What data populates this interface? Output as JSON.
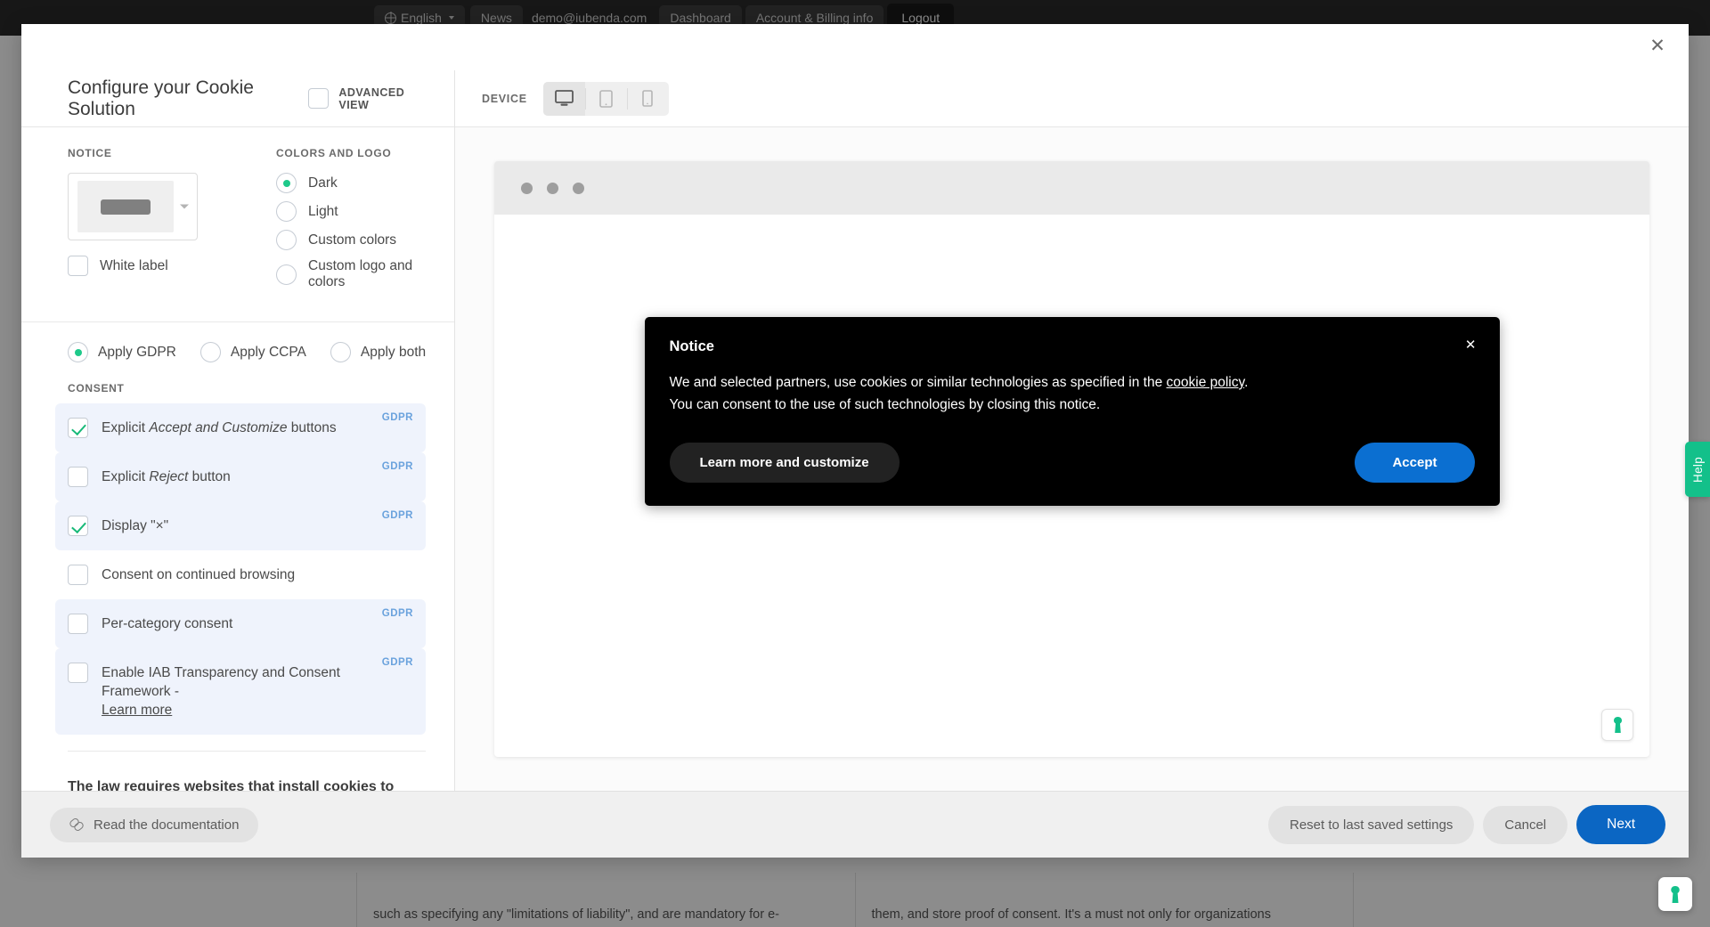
{
  "background": {
    "topbar": {
      "language": "English",
      "language_icon": "globe-icon",
      "news": "News",
      "email": "demo@iubenda.com",
      "dashboard": "Dashboard",
      "account_billing": "Account & Billing info",
      "logout": "Logout"
    },
    "columns": [
      {
        "text": "such as specifying any \"limitations of liability\", and are mandatory for e-"
      },
      {
        "text": "them, and store proof of consent. It's a must not only for organizations"
      }
    ]
  },
  "modal": {
    "close_icon": "close-icon",
    "left": {
      "title": "Configure your Cookie Solution",
      "advanced_view_label": "ADVANCED VIEW",
      "advanced_view_checked": false,
      "notice": {
        "section_label": "NOTICE",
        "white_label": "White label",
        "white_label_checked": false
      },
      "colors": {
        "section_label": "COLORS AND LOGO",
        "options": [
          {
            "label": "Dark",
            "selected": true
          },
          {
            "label": "Light",
            "selected": false
          },
          {
            "label": "Custom colors",
            "selected": false
          },
          {
            "label": "Custom logo and colors",
            "selected": false
          }
        ]
      },
      "law": {
        "options": [
          {
            "label": "Apply GDPR",
            "selected": true
          },
          {
            "label": "Apply CCPA",
            "selected": false
          },
          {
            "label": "Apply both",
            "selected": false
          }
        ]
      },
      "consent": {
        "section_label": "CONSENT",
        "items": [
          {
            "label_pre": "Explicit ",
            "label_em": "Accept and Customize",
            "label_post": " buttons",
            "checked": true,
            "badge": "GDPR",
            "highlighted": true,
            "learn_more": ""
          },
          {
            "label_pre": "Explicit ",
            "label_em": "Reject",
            "label_post": " button",
            "checked": false,
            "badge": "GDPR",
            "highlighted": true,
            "learn_more": ""
          },
          {
            "label_pre": "Display \"×\"",
            "label_em": "",
            "label_post": "",
            "checked": true,
            "badge": "GDPR",
            "highlighted": true,
            "learn_more": ""
          },
          {
            "label_pre": "Consent on continued browsing",
            "label_em": "",
            "label_post": "",
            "checked": false,
            "badge": "",
            "highlighted": false,
            "learn_more": ""
          },
          {
            "label_pre": "Per-category consent",
            "label_em": "",
            "label_post": "",
            "checked": false,
            "badge": "GDPR",
            "highlighted": true,
            "learn_more": ""
          },
          {
            "label_pre": "Enable IAB Transparency and Consent Framework - ",
            "label_em": "",
            "label_post": "",
            "checked": false,
            "badge": "GDPR",
            "highlighted": true,
            "learn_more": "Learn more"
          }
        ]
      },
      "law_footer_title": "The law requires websites that install cookies to provide a Privacy and Cookie Policy"
    },
    "right": {
      "device_label": "DEVICE",
      "devices": [
        {
          "icon": "desktop-icon",
          "active": true
        },
        {
          "icon": "tablet-icon",
          "active": false
        },
        {
          "icon": "mobile-icon",
          "active": false
        }
      ],
      "cookie_notice": {
        "title": "Notice",
        "close_icon": "close-icon",
        "body_line1_pre": "We and selected partners, use cookies or similar technologies as specified in the ",
        "body_link": "cookie policy",
        "body_line1_post": ".",
        "body_line2": "You can consent to the use of such technologies by closing this notice.",
        "learn_more_button": "Learn more and customize",
        "accept_button": "Accept",
        "bg_color": "#000000",
        "accept_color": "#0b6fd1"
      }
    },
    "footer": {
      "documentation_label": "Read the documentation",
      "documentation_icon": "link-icon",
      "reset_label": "Reset to last saved settings",
      "cancel_label": "Cancel",
      "next_label": "Next",
      "next_color": "#0b66c3"
    }
  },
  "widgets": {
    "help_tab_label": "Help",
    "help_tab_color": "#13c08a",
    "privacy_badge_icon": "iubenda-keyhole-icon"
  }
}
